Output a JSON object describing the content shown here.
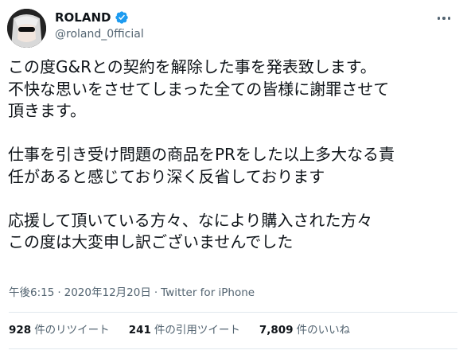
{
  "user": {
    "name": "ROLAND",
    "handle": "@roland_0fficial"
  },
  "tweet": {
    "paragraphs": [
      "この度G&Rとの契約を解除した事を発表致します。\n不快な思いをさせてしまった全ての皆様に謝罪させて\n頂きます。",
      "仕事を引き受け問題の商品をPRをした以上多大なる責\n任があると感じており深く反省しております",
      "応援して頂いている方々、なにより購入された方々\nこの度は大変申し訳ございませんでした"
    ],
    "time": "午後6:15",
    "separator": "·",
    "date": "2020年12月20日",
    "source": "Twitter for iPhone"
  },
  "stats": {
    "retweets_count": "928",
    "retweets_label": "件のリツイート",
    "quotes_count": "241",
    "quotes_label": "件の引用ツイート",
    "likes_count": "7,809",
    "likes_label": "件のいいね"
  },
  "colors": {
    "text": "#0f1419",
    "secondary": "#536471",
    "verified": "#1d9bf0",
    "divider": "#e1e8ed"
  },
  "icons": {
    "verified": "verified-badge-icon",
    "more": "more-icon"
  }
}
